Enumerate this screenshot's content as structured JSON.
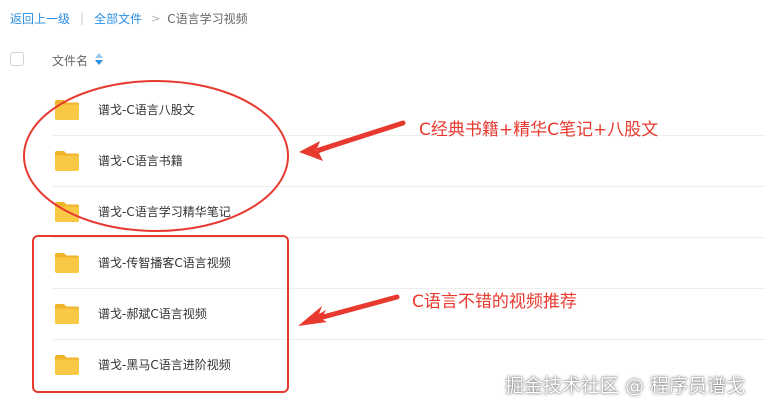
{
  "breadcrumb": {
    "back_label": "返回上一级",
    "separator": "|",
    "all_files_label": "全部文件",
    "arrow": ">",
    "current_label": "C语言学习视频"
  },
  "list_header": {
    "name_column": "文件名"
  },
  "files": [
    {
      "name": "谱戈-C语言八股文",
      "icon": "folder-icon"
    },
    {
      "name": "谱戈-C语言书籍",
      "icon": "folder-icon"
    },
    {
      "name": "谱戈-C语言学习精华笔记",
      "icon": "folder-icon"
    },
    {
      "name": "谱戈-传智播客C语言视频",
      "icon": "folder-icon"
    },
    {
      "name": "谱戈-郝斌C语言视频",
      "icon": "folder-icon"
    },
    {
      "name": "谱戈-黑马C语言进阶视频",
      "icon": "folder-icon"
    }
  ],
  "annotations": {
    "top_note": "C经典书籍+精华C笔记+八股文",
    "bottom_note": "C语言不错的视频推荐",
    "color": "#e8392f"
  },
  "watermark": "掘金技术社区 @ 程序员谱戈",
  "colors": {
    "link": "#2b8fe3",
    "folder": "#f8c53a",
    "annotation_red": "#e8392f"
  }
}
